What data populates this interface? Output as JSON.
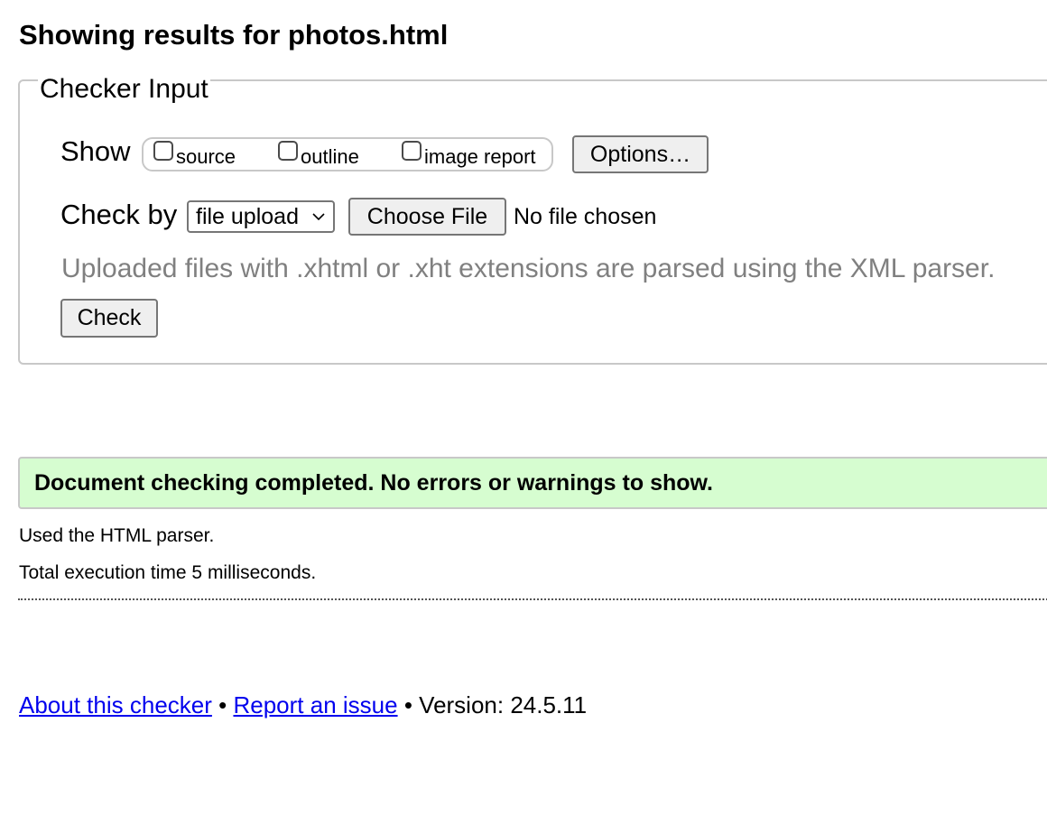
{
  "page": {
    "title": "Showing results for photos.html"
  },
  "checker_input": {
    "legend": "Checker Input",
    "show_label": "Show",
    "show_options": [
      {
        "label": "source",
        "checked": false
      },
      {
        "label": "outline",
        "checked": false
      },
      {
        "label": "image report",
        "checked": false
      }
    ],
    "options_button": "Options…",
    "check_by_label": "Check by",
    "check_by_select": "file upload",
    "choose_file_button": "Choose File",
    "file_status": "No file chosen",
    "hint": "Uploaded files with .xhtml or .xht extensions are parsed using the XML parser.",
    "check_button": "Check"
  },
  "results": {
    "success_message": "Document checking completed. No errors or warnings to show.",
    "parser_info": "Used the HTML parser.",
    "execution_time": "Total execution time 5 milliseconds."
  },
  "footer": {
    "about_link": "About this checker",
    "separator": "•",
    "report_link": "Report an issue",
    "version": "Version: 24.5.11"
  },
  "colors": {
    "success_bg": "#d6fdd0",
    "link": "#0000ee",
    "hint_text": "#808080",
    "border": "#c8c8c8"
  }
}
